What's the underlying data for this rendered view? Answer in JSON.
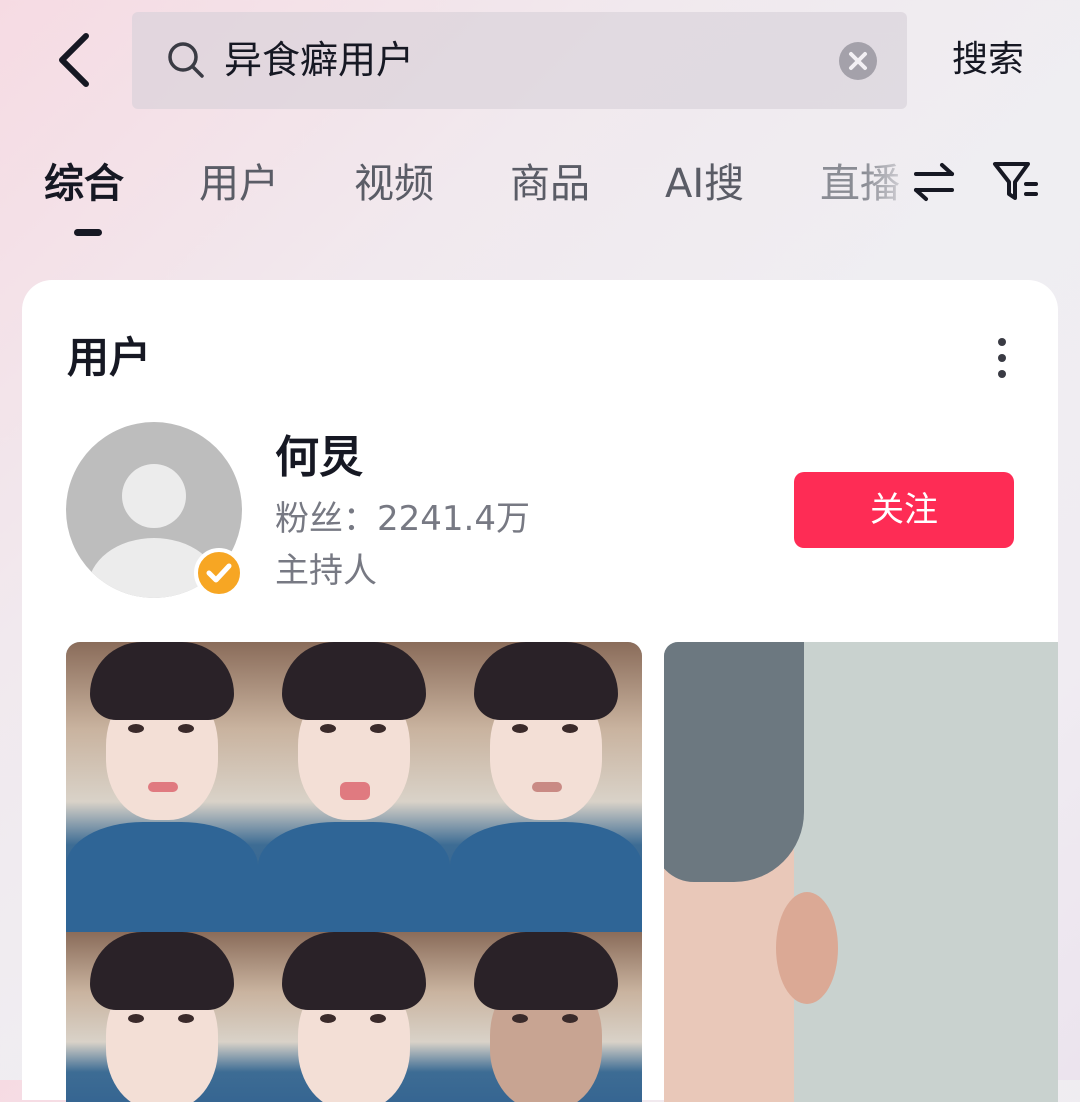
{
  "search": {
    "query": "异食癖用户",
    "button_label": "搜索"
  },
  "tabs": [
    {
      "label": "综合",
      "active": true
    },
    {
      "label": "用户",
      "active": false
    },
    {
      "label": "视频",
      "active": false
    },
    {
      "label": "商品",
      "active": false
    },
    {
      "label": "AI搜",
      "active": false
    },
    {
      "label": "直播",
      "active": false
    }
  ],
  "icons": {
    "back": "chevron-left-icon",
    "search": "search-icon",
    "clear": "clear-icon",
    "swap": "swap-icon",
    "filter": "filter-icon",
    "more": "more-vertical-icon",
    "verified": "verified-check-icon"
  },
  "user_section": {
    "title": "用户",
    "user": {
      "name": "何炅",
      "fans": "粉丝：2241.4万",
      "role": "主持人",
      "follow_label": "关注"
    }
  },
  "colors": {
    "accent": "#fe2c55",
    "verified_badge": "#f7a623"
  }
}
